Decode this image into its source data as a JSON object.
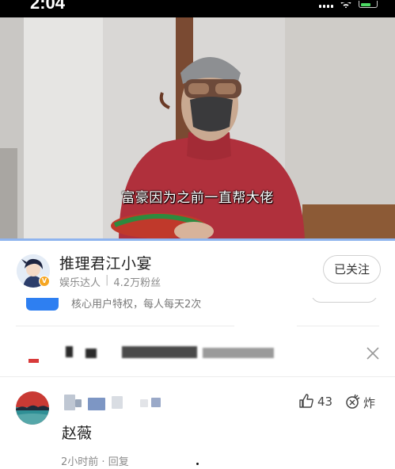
{
  "status_bar": {
    "time": "2:04"
  },
  "video": {
    "subtitle": "富豪因为之前一直帮大佬"
  },
  "author": {
    "name": "推理君江小宴",
    "category": "娱乐达人",
    "followers": "4.2万粉丝",
    "follow_label": "已关注"
  },
  "promo": {
    "text": "核心用户特权，每人每天2次"
  },
  "comment": {
    "text": "赵薇",
    "likes": "43",
    "bomb_label": "炸",
    "time": "2小时前",
    "reply_label": "回复"
  },
  "colors": {
    "accent": "#2e7ff1",
    "progress": "#8fb4ef",
    "badge": "#f5a623"
  },
  "icons": [
    "signal-icon",
    "wifi-icon",
    "battery-icon",
    "verified-icon",
    "close-icon",
    "like-icon",
    "bomb-icon"
  ]
}
